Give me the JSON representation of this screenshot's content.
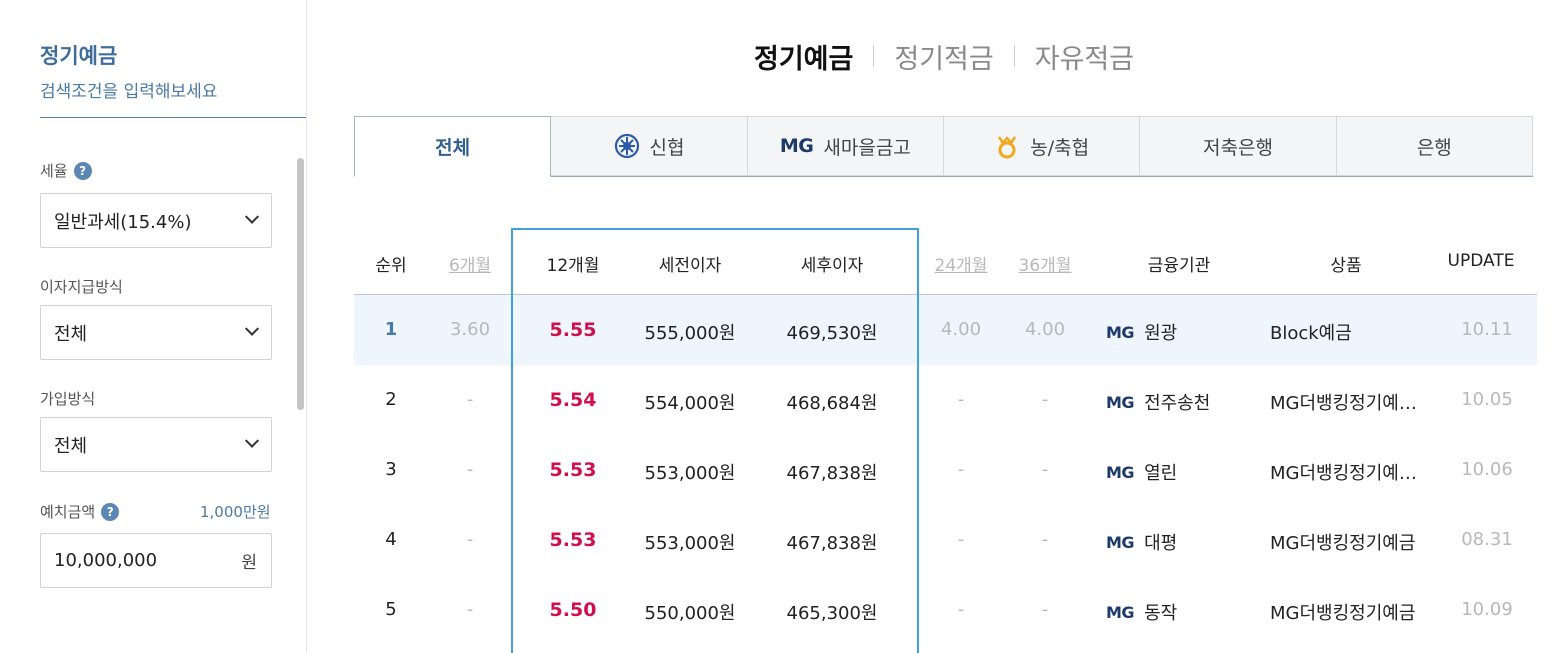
{
  "sidebar": {
    "title": "정기예금",
    "subtitle": "검색조건을 입력해보세요",
    "tax": {
      "label": "세율",
      "help_icon": "question-icon",
      "value": "일반과세(15.4%)"
    },
    "interest": {
      "label": "이자지급방식",
      "value": "전체"
    },
    "join": {
      "label": "가입방식",
      "value": "전체"
    },
    "deposit": {
      "label": "예치금액",
      "help_icon": "question-icon",
      "amount_display": "1,000만원",
      "value": "10,000,000",
      "unit": "원"
    }
  },
  "top_tabs": [
    {
      "label": "정기예금",
      "active": true
    },
    {
      "label": "정기적금",
      "active": false
    },
    {
      "label": "자유적금",
      "active": false
    }
  ],
  "category_tabs": [
    {
      "label": "전체",
      "icon": "",
      "active": true
    },
    {
      "label": "신협",
      "icon": "shinhyup-logo-icon",
      "active": false
    },
    {
      "label": "새마을금고",
      "icon": "mg-logo",
      "logo_text": "MG",
      "active": false
    },
    {
      "label": "농/축협",
      "icon": "nonghyup-logo-icon",
      "active": false
    },
    {
      "label": "저축은행",
      "icon": "",
      "active": false
    },
    {
      "label": "은행",
      "icon": "",
      "active": false
    }
  ],
  "table": {
    "headers": {
      "rank": "순위",
      "m6": "6개월",
      "m12": "12개월",
      "pre_tax": "세전이자",
      "post_tax": "세후이자",
      "m24": "24개월",
      "m36": "36개월",
      "institution": "금융기관",
      "product": "상품",
      "update": "UPDATE"
    },
    "rows": [
      {
        "rank": "1",
        "m6": "3.60",
        "m12": "5.55",
        "pre_tax": "555,000원",
        "post_tax": "469,530원",
        "m24": "4.00",
        "m36": "4.00",
        "logo": "MG",
        "institution": "원광",
        "product": "Block예금",
        "update": "10.11"
      },
      {
        "rank": "2",
        "m6": "-",
        "m12": "5.54",
        "pre_tax": "554,000원",
        "post_tax": "468,684원",
        "m24": "-",
        "m36": "-",
        "logo": "MG",
        "institution": "전주송천",
        "product": "MG더뱅킹정기예…",
        "update": "10.05"
      },
      {
        "rank": "3",
        "m6": "-",
        "m12": "5.53",
        "pre_tax": "553,000원",
        "post_tax": "467,838원",
        "m24": "-",
        "m36": "-",
        "logo": "MG",
        "institution": "열린",
        "product": "MG더뱅킹정기예…",
        "update": "10.06"
      },
      {
        "rank": "4",
        "m6": "-",
        "m12": "5.53",
        "pre_tax": "553,000원",
        "post_tax": "467,838원",
        "m24": "-",
        "m36": "-",
        "logo": "MG",
        "institution": "대평",
        "product": "MG더뱅킹정기예금",
        "update": "08.31"
      },
      {
        "rank": "5",
        "m6": "-",
        "m12": "5.50",
        "pre_tax": "550,000원",
        "post_tax": "465,300원",
        "m24": "-",
        "m36": "-",
        "logo": "MG",
        "institution": "동작",
        "product": "MG더뱅킹정기예금",
        "update": "10.09"
      }
    ]
  },
  "colors": {
    "accent": "#3f6e9a",
    "rate": "#d0104c",
    "highlight_border": "#3fa2dc",
    "highlight_row": "#eef5fc"
  }
}
